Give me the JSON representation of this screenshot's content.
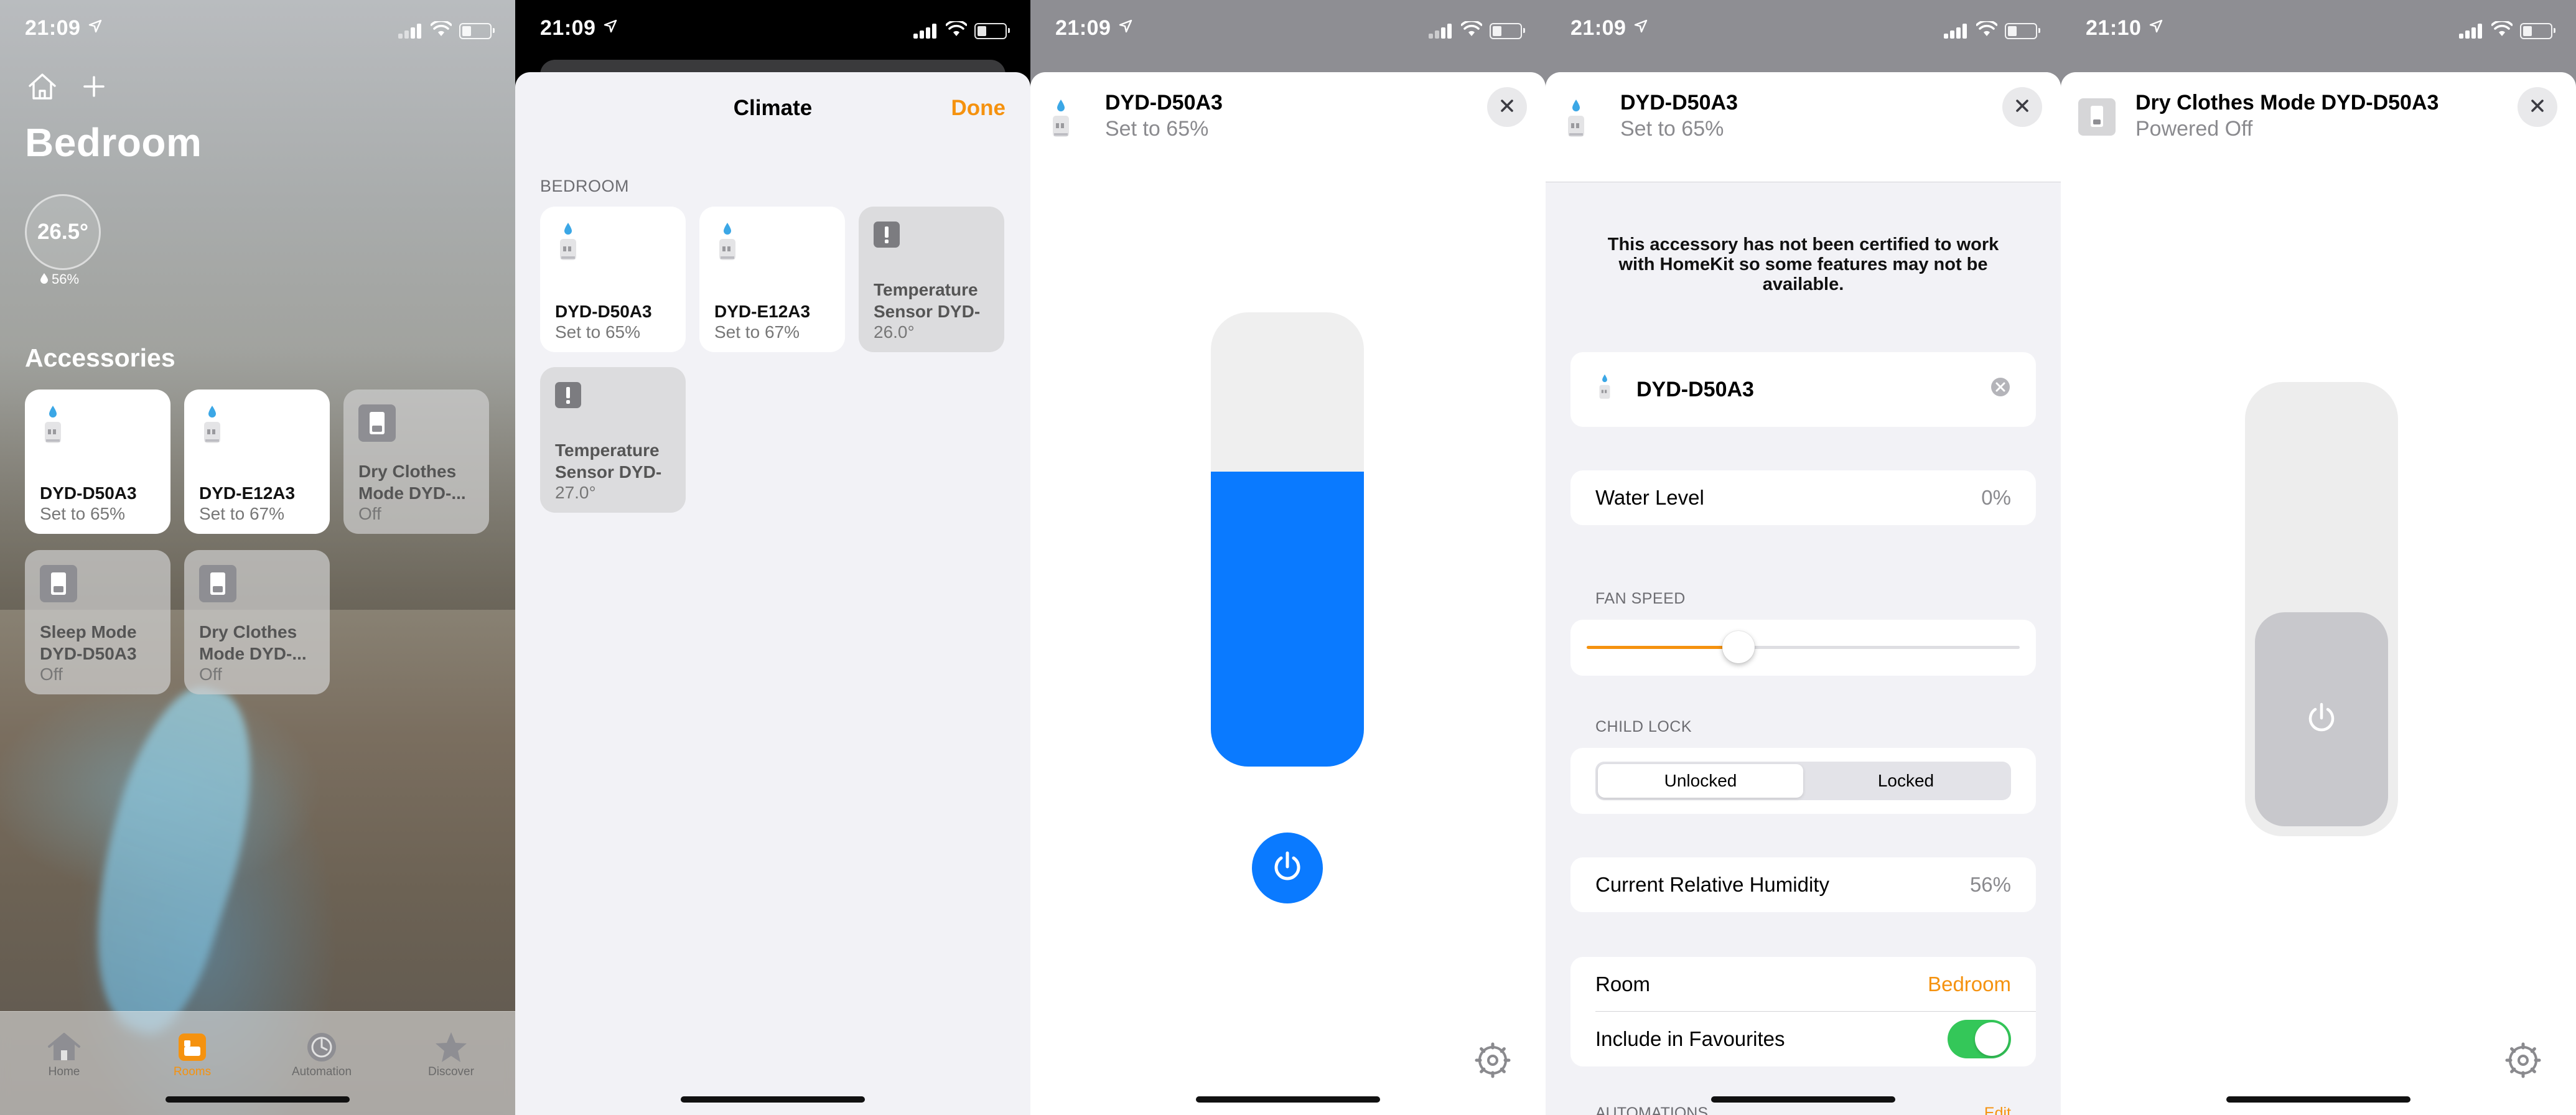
{
  "status": {
    "p1_time": "21:09",
    "p2_time": "21:09",
    "p3_time": "21:09",
    "p4_time": "21:09",
    "p5_time": "21:10"
  },
  "home": {
    "room_title": "Bedroom",
    "temperature": "26.5°",
    "humidity": "56%",
    "accessories_heading": "Accessories",
    "tiles": [
      {
        "name": "DYD-D50A3",
        "status": "Set to 65%"
      },
      {
        "name": "DYD-E12A3",
        "status": "Set to 67%"
      },
      {
        "name": "Dry Clothes Mode DYD-...",
        "status": "Off"
      },
      {
        "name": "Sleep Mode DYD-D50A3",
        "status": "Off"
      },
      {
        "name": "Dry Clothes Mode DYD-...",
        "status": "Off"
      }
    ],
    "tabs": [
      {
        "label": "Home",
        "icon": "house-icon"
      },
      {
        "label": "Rooms",
        "icon": "rooms-icon"
      },
      {
        "label": "Automation",
        "icon": "automation-icon"
      },
      {
        "label": "Discover",
        "icon": "star-icon"
      }
    ]
  },
  "climate": {
    "title": "Climate",
    "done_label": "Done",
    "group_label": "BEDROOM",
    "tiles": [
      {
        "name": "DYD-D50A3",
        "status": "Set to 65%"
      },
      {
        "name": "DYD-E12A3",
        "status": "Set to 67%"
      },
      {
        "name": "Temperature Sensor DYD-",
        "status": "26.0°"
      },
      {
        "name": "Temperature Sensor DYD-",
        "status": "27.0°"
      }
    ]
  },
  "dehumidifier": {
    "title": "DYD-D50A3",
    "subtitle": "Set to 65%",
    "target_humidity_percent": 65
  },
  "settings": {
    "title": "DYD-D50A3",
    "subtitle": "Set to 65%",
    "notice": "This accessory has not been certified to work with HomeKit so some features may not be available.",
    "accessory_name": "DYD-D50A3",
    "water_level_label": "Water Level",
    "water_level_value": "0%",
    "fan_speed_label": "FAN SPEED",
    "fan_speed_fraction": 0.35,
    "child_lock_label": "CHILD LOCK",
    "child_lock_options": [
      "Unlocked",
      "Locked"
    ],
    "child_lock_selected": "Unlocked",
    "humidity_label": "Current Relative Humidity",
    "humidity_value": "56%",
    "room_label": "Room",
    "room_value": "Bedroom",
    "favourites_label": "Include in Favourites",
    "favourites_on": true,
    "cut_section_label": "AUTOMATIONS",
    "cut_edit_label": "Edit"
  },
  "dry_mode": {
    "title": "Dry Clothes Mode DYD-D50A3",
    "subtitle": "Powered Off"
  },
  "colors": {
    "accent_orange": "#f5920f",
    "blue": "#0a7aff",
    "toggle_green": "#34c759"
  }
}
